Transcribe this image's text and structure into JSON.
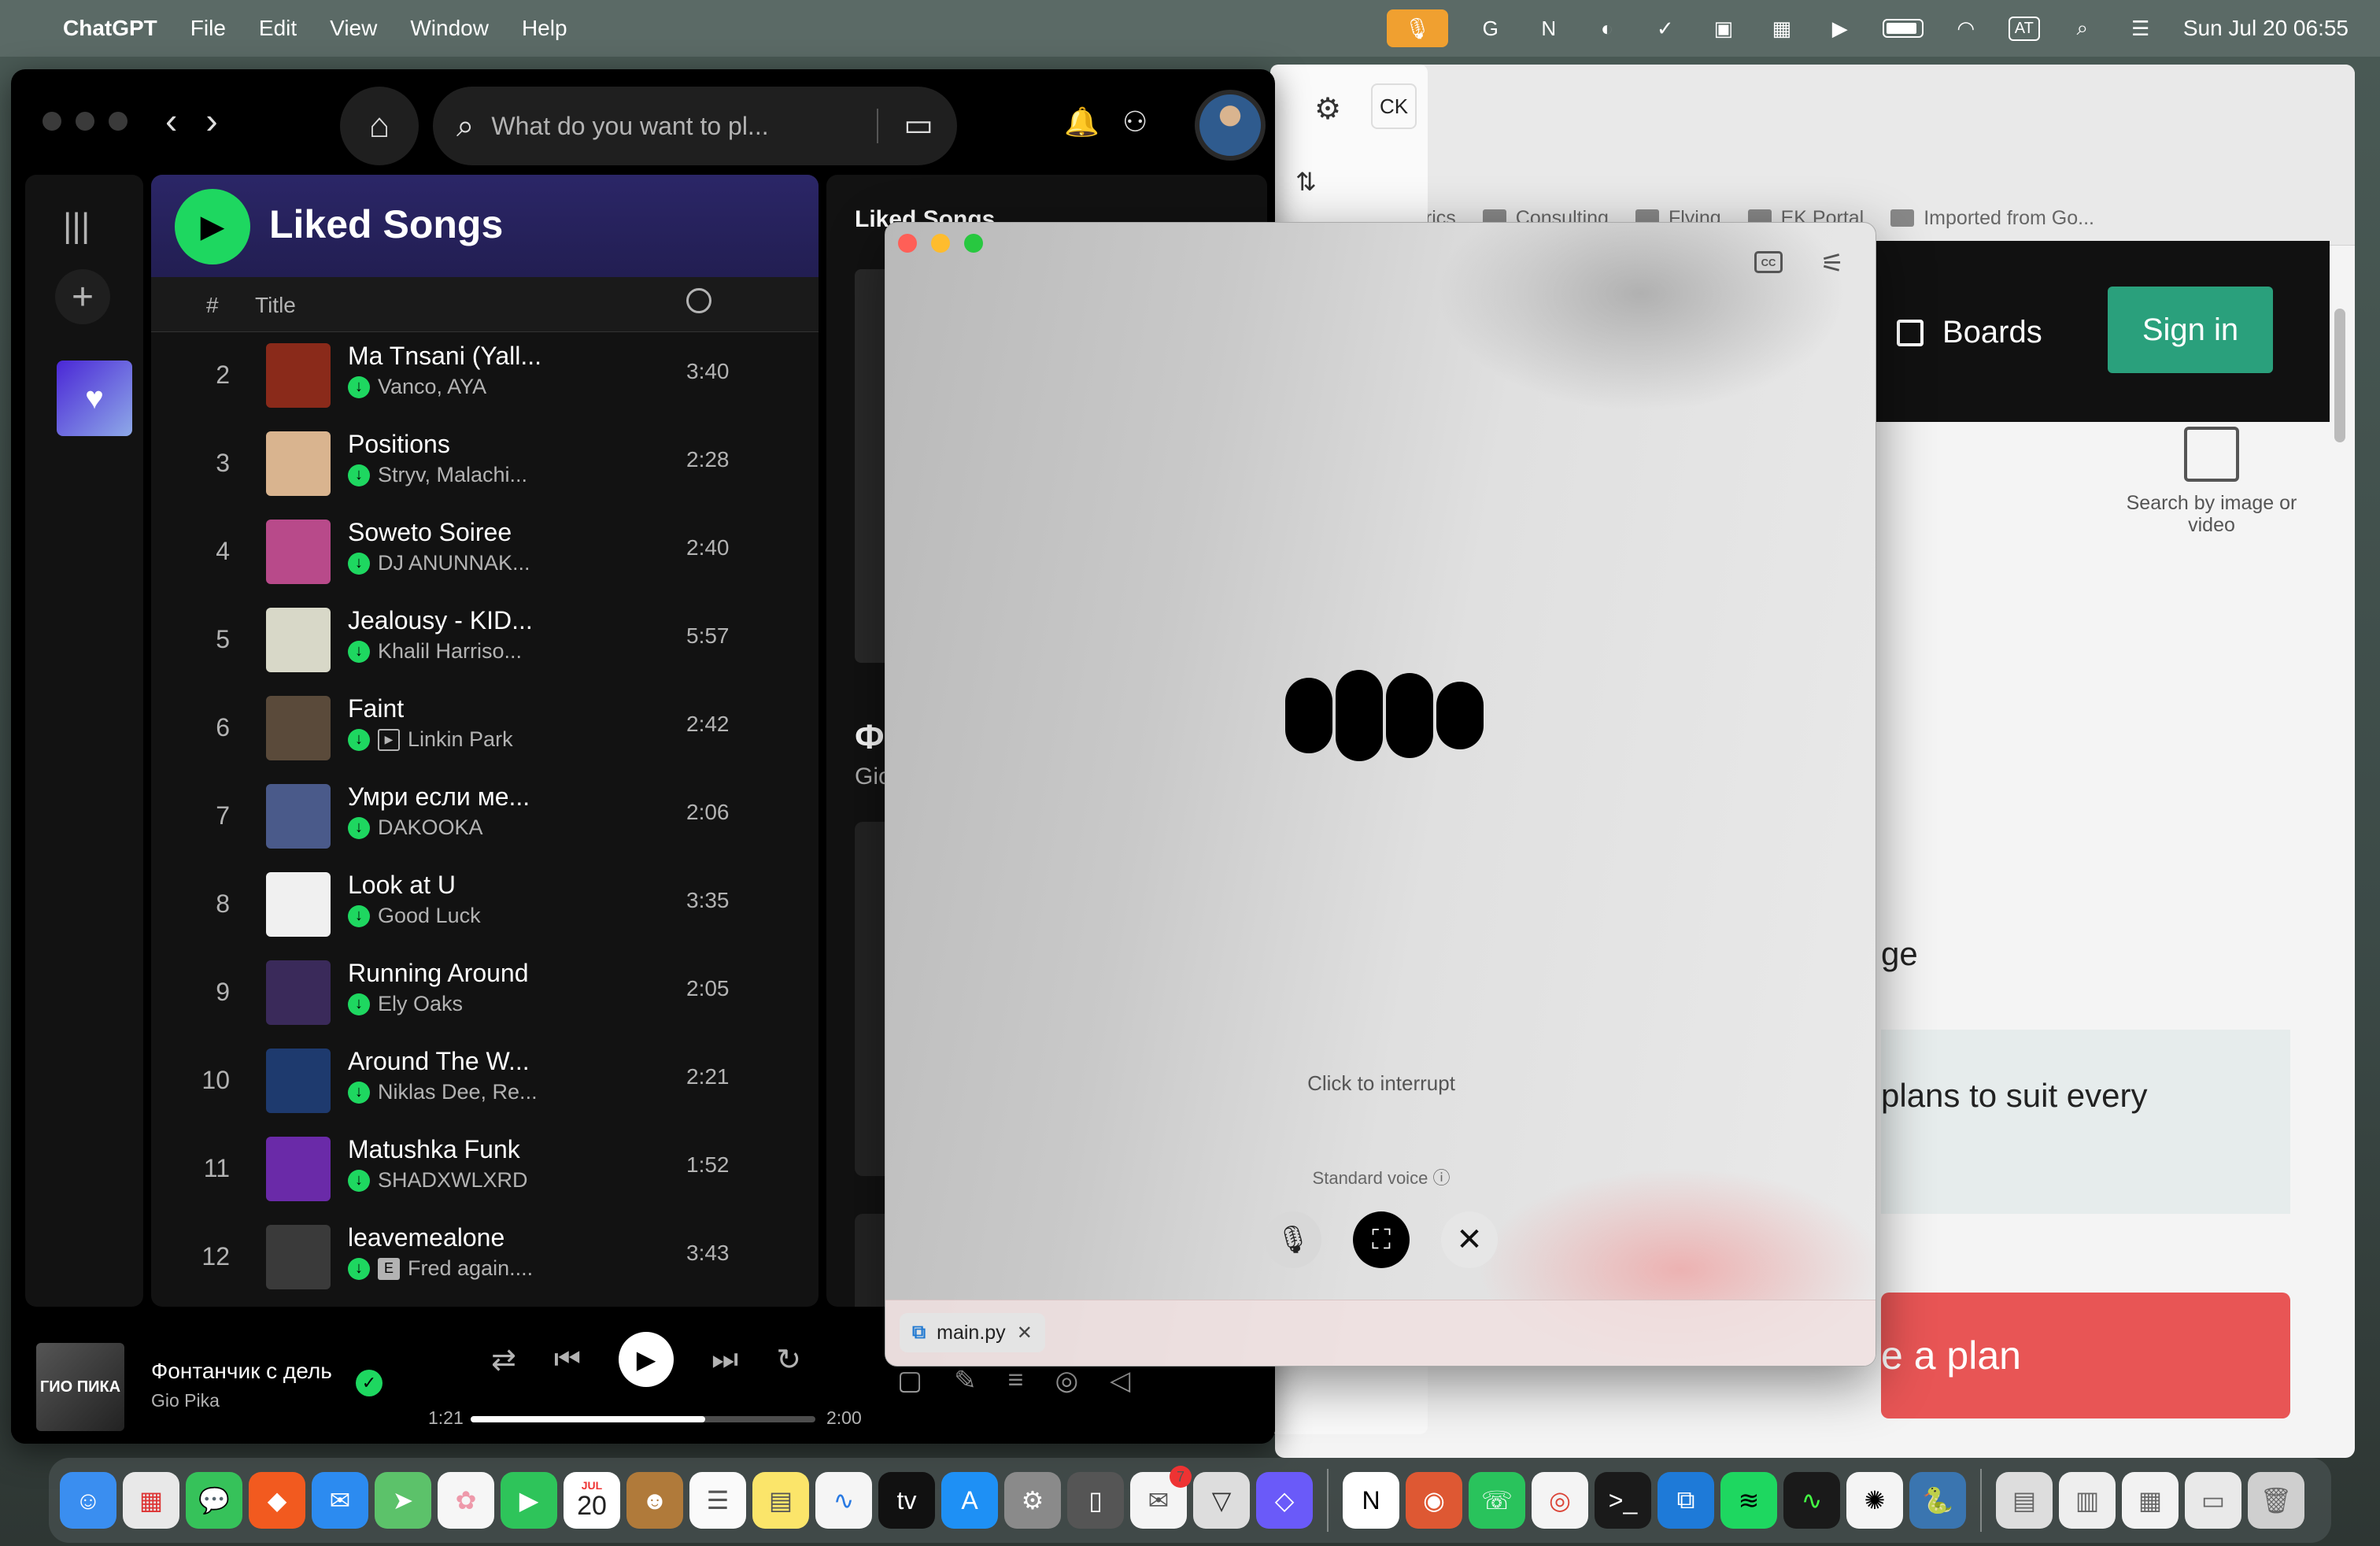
{
  "menubar": {
    "app_name": "ChatGPT",
    "menus": [
      "File",
      "Edit",
      "View",
      "Window",
      "Help"
    ],
    "clock": "Sun Jul 20  06:55",
    "keyboard_indicator": "AT"
  },
  "browser": {
    "bookmarks": [
      "KPI Metrics",
      "Consulting",
      "Flying",
      "EK Portal",
      "Imported from Go..."
    ],
    "boards_label": "Boards",
    "sign_in_label": "Sign in",
    "search_by_image": "Search by image or video",
    "text_fragment_1": "ge",
    "text_fragment_2": "plans to suit every",
    "cta_fragment": "e a plan"
  },
  "chatgpt_sidebar": {
    "user_initials": "CK"
  },
  "spotify": {
    "search_placeholder": "What do you want to pl...",
    "playlist_title": "Liked Songs",
    "column_number": "#",
    "column_title": "Title",
    "tracks": [
      {
        "num": "2",
        "name": "Ma Tnsani (Yall...",
        "artist": "Vanco, AYA",
        "duration": "3:40",
        "badge": "",
        "color": "#8a2a1a"
      },
      {
        "num": "3",
        "name": "Positions",
        "artist": "Stryv, Malachi...",
        "duration": "2:28",
        "badge": "",
        "color": "#d9b48f"
      },
      {
        "num": "4",
        "name": "Soweto Soiree",
        "artist": "DJ ANUNNAK...",
        "duration": "2:40",
        "badge": "",
        "color": "#b84a8a"
      },
      {
        "num": "5",
        "name": "Jealousy - KID...",
        "artist": "Khalil Harriso...",
        "duration": "5:57",
        "badge": "",
        "color": "#d8d8c8"
      },
      {
        "num": "6",
        "name": "Faint",
        "artist": "Linkin Park",
        "duration": "2:42",
        "badge": "video",
        "color": "#5a4a3a"
      },
      {
        "num": "7",
        "name": "Умри если ме...",
        "artist": "DAKOOKA",
        "duration": "2:06",
        "badge": "",
        "color": "#4a5a8a"
      },
      {
        "num": "8",
        "name": "Look at U",
        "artist": "Good Luck",
        "duration": "3:35",
        "badge": "",
        "color": "#f0f0f0"
      },
      {
        "num": "9",
        "name": "Running Around",
        "artist": "Ely Oaks",
        "duration": "2:05",
        "badge": "",
        "color": "#3a2a5a"
      },
      {
        "num": "10",
        "name": "Around The W...",
        "artist": "Niklas Dee, Re...",
        "duration": "2:21",
        "badge": "",
        "color": "#1e3a6e"
      },
      {
        "num": "11",
        "name": "Matushka Funk",
        "artist": "SHADXWLXRD",
        "duration": "1:52",
        "badge": "",
        "color": "#6a2aa8"
      },
      {
        "num": "12",
        "name": "leavemealone",
        "artist": "Fred again....",
        "duration": "3:43",
        "badge": "E",
        "color": "#3a3a3a"
      }
    ],
    "right_panel_title": "Liked Songs",
    "right_panel_song": "Фо",
    "right_panel_artist": "Gio",
    "now_playing": {
      "art_text": "ГИО ПИКА",
      "title": "Фонтанчик с дель",
      "artist": "Gio Pika",
      "elapsed": "1:21",
      "total": "2:00",
      "progress": 0.68
    }
  },
  "voice_window": {
    "interrupt_label": "Click to interrupt",
    "voice_mode": "Standard voice",
    "attachment": "main.py"
  },
  "dock": {
    "calendar_month": "JUL",
    "calendar_day": "20",
    "mail_badge": "7"
  }
}
